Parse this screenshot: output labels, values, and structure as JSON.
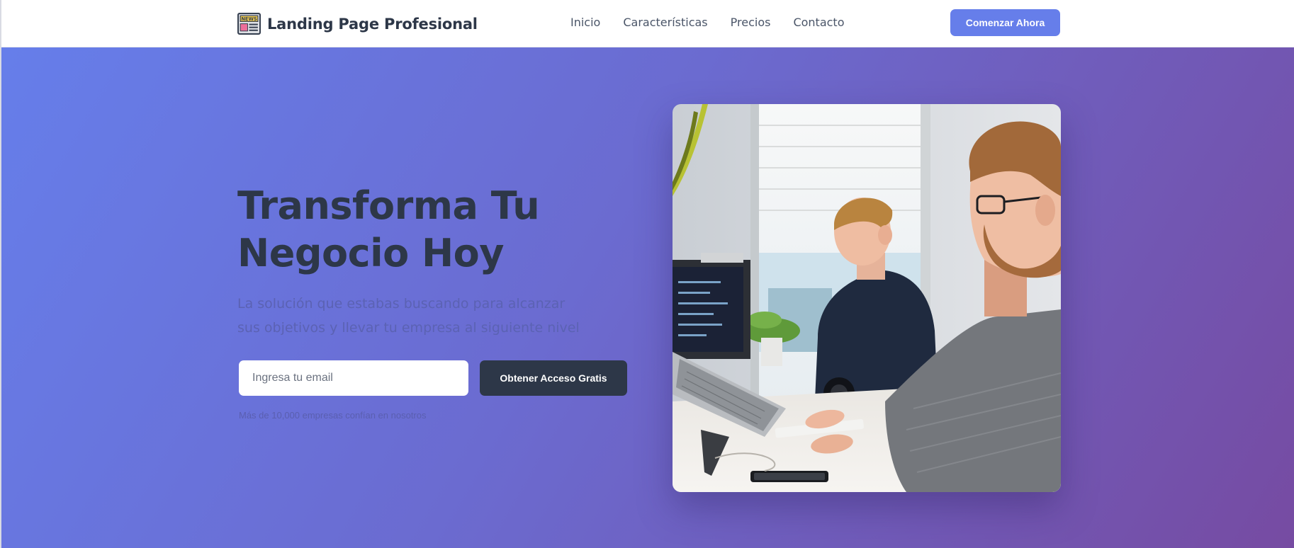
{
  "header": {
    "brand_name": "Landing Page Profesional",
    "brand_icon": "newspaper-icon",
    "nav": [
      "Inicio",
      "Características",
      "Precios",
      "Contacto"
    ],
    "cta_label": "Comenzar Ahora"
  },
  "hero": {
    "title_line1": "Transforma Tu",
    "title_line2": "Negocio Hoy",
    "subtitle": "La solución que estabas buscando para alcanzar sus objetivos y llevar tu empresa al siguiente nivel",
    "email_placeholder": "Ingresa tu email",
    "submit_label": "Obtener Acceso Gratis",
    "trust_note": "Más de 10,000 empresas confían en nosotros"
  },
  "colors": {
    "accent": "#667eea",
    "gradient_end": "#764ba2",
    "dark": "#2d3748"
  }
}
